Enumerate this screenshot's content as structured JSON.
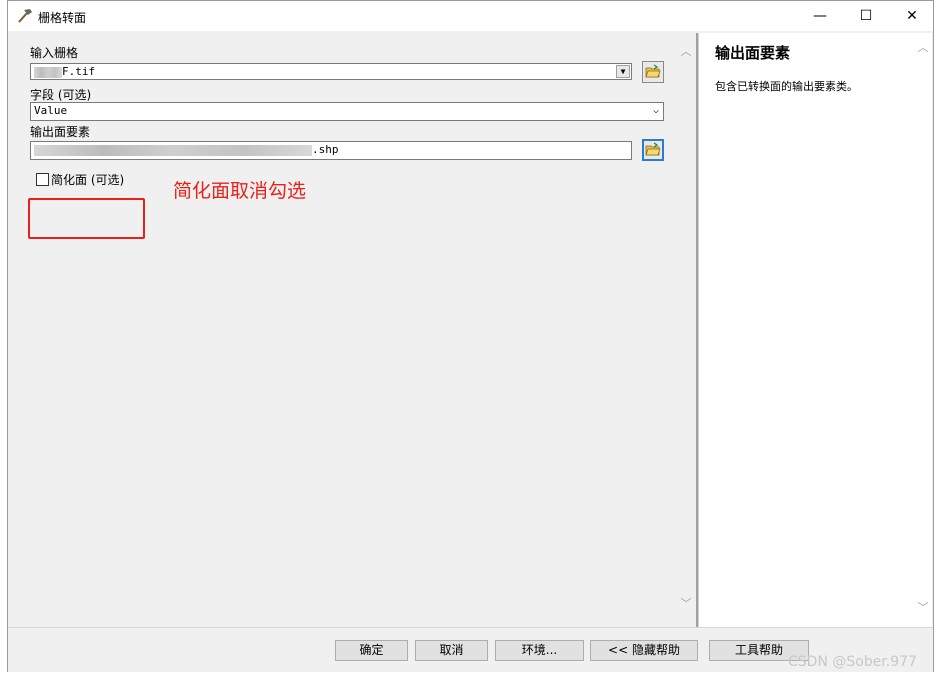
{
  "window": {
    "title": "栅格转面",
    "controls": {
      "minimize": "—",
      "maximize": "☐",
      "close": "✕"
    }
  },
  "form": {
    "input_raster": {
      "label": "输入栅格",
      "value": "F.tif"
    },
    "field": {
      "label": "字段 (可选)",
      "value": "Value"
    },
    "output_features": {
      "label": "输出面要素",
      "value": ".shp"
    },
    "simplify": {
      "label": "简化面 (可选)",
      "checked": false
    }
  },
  "annotation": {
    "text": "简化面取消勾选",
    "color": "#e8211b"
  },
  "help": {
    "title": "输出面要素",
    "text": "包含已转换面的输出要素类。"
  },
  "buttons": {
    "ok": "确定",
    "cancel": "取消",
    "environments": "环境...",
    "hide_help": "<< 隐藏帮助",
    "tool_help": "工具帮助"
  },
  "watermark": "CSDN @Sober.977",
  "icons": {
    "title": "hammer-icon",
    "browse": "folder-open-icon"
  },
  "colors": {
    "accent": "#2a7bd4",
    "annotation": "#e8211b"
  }
}
